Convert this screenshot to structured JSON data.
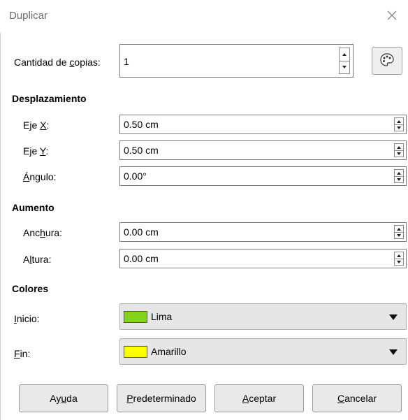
{
  "title": "Duplicar",
  "copies": {
    "label_pre": "Cantidad de ",
    "label_u": "c",
    "label_post": "opias:",
    "value": "1"
  },
  "desplazamiento": {
    "heading": "Desplazamiento",
    "x": {
      "pre": "Eje ",
      "u": "X",
      "post": ":",
      "value": "0.50 cm"
    },
    "y": {
      "pre": "Eje ",
      "u": "Y",
      "post": ":",
      "value": "0.50 cm"
    },
    "angle": {
      "pre": "",
      "u": "Á",
      "post": "ngulo:",
      "value": "0.00°"
    }
  },
  "aumento": {
    "heading": "Aumento",
    "width": {
      "pre": "Anc",
      "u": "h",
      "post": "ura:",
      "value": "0.00 cm"
    },
    "height": {
      "pre": "A",
      "u": "l",
      "post": "tura:",
      "value": "0.00 cm"
    }
  },
  "colores": {
    "heading": "Colores",
    "start": {
      "pre": "",
      "u": "I",
      "post": "nicio:",
      "color_name": "Lima",
      "swatch": "#81d41a"
    },
    "end": {
      "pre": "",
      "u": "F",
      "post": "in:",
      "color_name": "Amarillo",
      "swatch": "#ffff00"
    }
  },
  "buttons": {
    "help": {
      "pre": "Ay",
      "u": "u",
      "post": "da"
    },
    "default": {
      "pre": "",
      "u": "P",
      "post": "redeterminado"
    },
    "ok": {
      "pre": "",
      "u": "A",
      "post": "ceptar"
    },
    "cancel": {
      "pre": "",
      "u": "C",
      "post": "ancelar"
    }
  }
}
